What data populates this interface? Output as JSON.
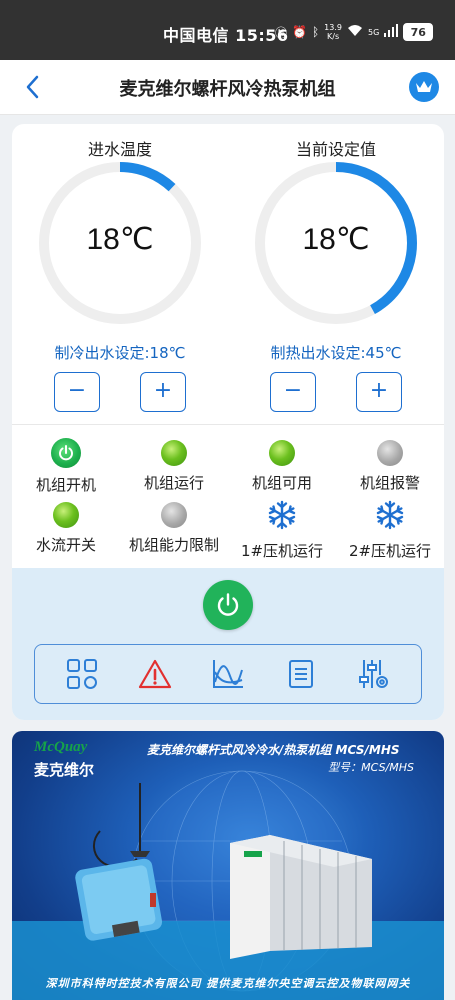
{
  "status_bar": {
    "carrier_time": "中国电信 15:56",
    "net_speed_value": "13.9",
    "net_speed_unit": "K/s",
    "network": "5G",
    "battery": "76"
  },
  "header": {
    "title": "麦克维尔螺杆风冷热泵机组",
    "back_icon": "chevron-left-icon",
    "crown_icon": "crown-icon"
  },
  "gauges": {
    "inlet": {
      "title": "进水温度",
      "value": "18℃",
      "fill_fraction": 0.12,
      "color": "#1e88e5"
    },
    "setpoint": {
      "title": "当前设定值",
      "value": "18℃",
      "fill_fraction": 0.42,
      "color": "#1e88e5"
    }
  },
  "setpoints": {
    "cooling_label": "制冷出水设定:18℃",
    "heating_label": "制热出水设定:45℃",
    "minus": "−",
    "plus": "+"
  },
  "status_items": [
    {
      "label": "机组开机",
      "indicator": "power-lamp",
      "color": "#1db04d"
    },
    {
      "label": "机组运行",
      "indicator": "green-lamp",
      "color": "#6cc01f"
    },
    {
      "label": "机组可用",
      "indicator": "green-lamp",
      "color": "#6cc01f"
    },
    {
      "label": "机组报警",
      "indicator": "gray-lamp",
      "color": "#a8a8a8"
    },
    {
      "label": "水流开关",
      "indicator": "green-lamp",
      "color": "#6cc01f"
    },
    {
      "label": "机组能力限制",
      "indicator": "gray-lamp",
      "color": "#a8a8a8"
    },
    {
      "label": "1#压机运行",
      "indicator": "snowflake-icon",
      "color": "#1e6fd0"
    },
    {
      "label": "2#压机运行",
      "indicator": "snowflake-icon",
      "color": "#1e6fd0"
    }
  ],
  "toolbar": {
    "items": [
      "grid-menu-icon",
      "alarm-warning-icon",
      "trend-chart-icon",
      "list-document-icon",
      "settings-sliders-icon"
    ],
    "power_icon": "power-icon"
  },
  "banner": {
    "brand_en": "McQuay",
    "brand_cn": "麦克维尔",
    "heading": "麦克维尔螺杆式风冷冷水/热泵机组 MCS/MHS",
    "model": "型号：MCS/MHS",
    "footer": "深圳市科特时控技术有限公司  提供麦克维尔央空调云控及物联网网关"
  }
}
